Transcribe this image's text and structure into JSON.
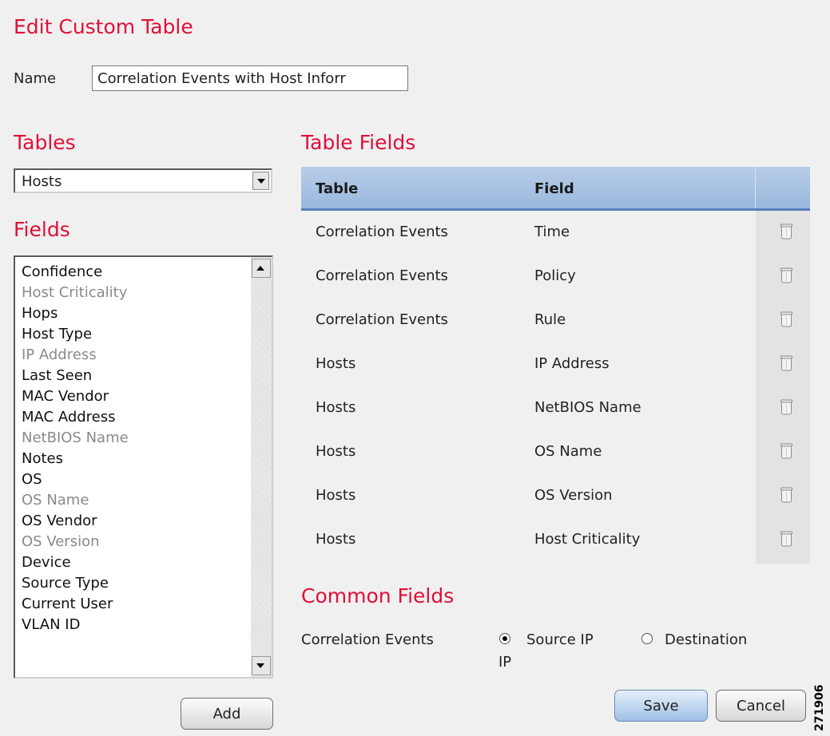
{
  "page_title": "Edit Custom Table",
  "name_label": "Name",
  "name_value": "Correlation Events with Host Inforr",
  "tables_heading": "Tables",
  "tables_select_value": "Hosts",
  "fields_heading": "Fields",
  "fields_list": [
    {
      "label": "Confidence",
      "dimmed": false
    },
    {
      "label": "Host Criticality",
      "dimmed": true
    },
    {
      "label": "Hops",
      "dimmed": false
    },
    {
      "label": "Host Type",
      "dimmed": false
    },
    {
      "label": "IP Address",
      "dimmed": true
    },
    {
      "label": "Last Seen",
      "dimmed": false
    },
    {
      "label": "MAC Vendor",
      "dimmed": false
    },
    {
      "label": "MAC Address",
      "dimmed": false
    },
    {
      "label": "NetBIOS Name",
      "dimmed": true
    },
    {
      "label": "Notes",
      "dimmed": false
    },
    {
      "label": "OS",
      "dimmed": false
    },
    {
      "label": "OS Name",
      "dimmed": true
    },
    {
      "label": "OS Vendor",
      "dimmed": false
    },
    {
      "label": "OS Version",
      "dimmed": true
    },
    {
      "label": "Device",
      "dimmed": false
    },
    {
      "label": "Source Type",
      "dimmed": false
    },
    {
      "label": "Current User",
      "dimmed": false
    },
    {
      "label": "VLAN ID",
      "dimmed": false
    }
  ],
  "add_button_label": "Add",
  "table_fields_heading": "Table Fields",
  "table_fields_columns": {
    "table": "Table",
    "field": "Field"
  },
  "table_fields_rows": [
    {
      "table": "Correlation Events",
      "field": "Time"
    },
    {
      "table": "Correlation Events",
      "field": "Policy"
    },
    {
      "table": "Correlation Events",
      "field": "Rule"
    },
    {
      "table": "Hosts",
      "field": "IP Address"
    },
    {
      "table": "Hosts",
      "field": "NetBIOS Name"
    },
    {
      "table": "Hosts",
      "field": "OS Name"
    },
    {
      "table": "Hosts",
      "field": "OS Version"
    },
    {
      "table": "Hosts",
      "field": "Host Criticality"
    }
  ],
  "delete_icon": "trash-icon",
  "common_fields_heading": "Common Fields",
  "common_fields": {
    "label": "Correlation Events",
    "option_source": "Source IP",
    "option_destination_line1": "Destination",
    "option_destination_line2": "IP",
    "selected": "source"
  },
  "save_button_label": "Save",
  "cancel_button_label": "Cancel",
  "figure_id": "271906",
  "colors": {
    "heading": "#e0103a",
    "table_header": "#a9c3e3",
    "disabled_text": "#8a8a8a"
  }
}
